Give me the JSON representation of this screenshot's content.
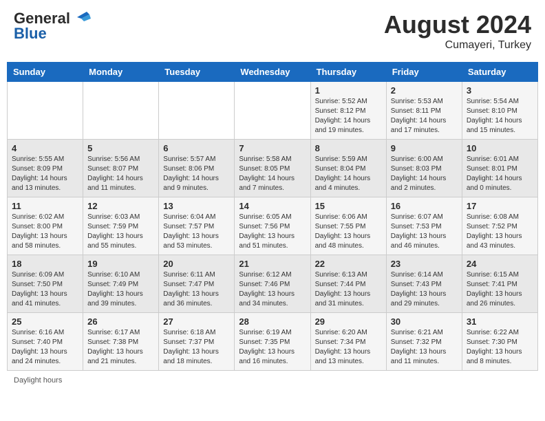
{
  "header": {
    "logo_line1": "General",
    "logo_line2": "Blue",
    "month_year": "August 2024",
    "location": "Cumayeri, Turkey"
  },
  "footer": {
    "daylight_label": "Daylight hours"
  },
  "days_of_week": [
    "Sunday",
    "Monday",
    "Tuesday",
    "Wednesday",
    "Thursday",
    "Friday",
    "Saturday"
  ],
  "weeks": [
    [
      {
        "day": "",
        "info": ""
      },
      {
        "day": "",
        "info": ""
      },
      {
        "day": "",
        "info": ""
      },
      {
        "day": "",
        "info": ""
      },
      {
        "day": "1",
        "info": "Sunrise: 5:52 AM\nSunset: 8:12 PM\nDaylight: 14 hours and 19 minutes."
      },
      {
        "day": "2",
        "info": "Sunrise: 5:53 AM\nSunset: 8:11 PM\nDaylight: 14 hours and 17 minutes."
      },
      {
        "day": "3",
        "info": "Sunrise: 5:54 AM\nSunset: 8:10 PM\nDaylight: 14 hours and 15 minutes."
      }
    ],
    [
      {
        "day": "4",
        "info": "Sunrise: 5:55 AM\nSunset: 8:09 PM\nDaylight: 14 hours and 13 minutes."
      },
      {
        "day": "5",
        "info": "Sunrise: 5:56 AM\nSunset: 8:07 PM\nDaylight: 14 hours and 11 minutes."
      },
      {
        "day": "6",
        "info": "Sunrise: 5:57 AM\nSunset: 8:06 PM\nDaylight: 14 hours and 9 minutes."
      },
      {
        "day": "7",
        "info": "Sunrise: 5:58 AM\nSunset: 8:05 PM\nDaylight: 14 hours and 7 minutes."
      },
      {
        "day": "8",
        "info": "Sunrise: 5:59 AM\nSunset: 8:04 PM\nDaylight: 14 hours and 4 minutes."
      },
      {
        "day": "9",
        "info": "Sunrise: 6:00 AM\nSunset: 8:03 PM\nDaylight: 14 hours and 2 minutes."
      },
      {
        "day": "10",
        "info": "Sunrise: 6:01 AM\nSunset: 8:01 PM\nDaylight: 14 hours and 0 minutes."
      }
    ],
    [
      {
        "day": "11",
        "info": "Sunrise: 6:02 AM\nSunset: 8:00 PM\nDaylight: 13 hours and 58 minutes."
      },
      {
        "day": "12",
        "info": "Sunrise: 6:03 AM\nSunset: 7:59 PM\nDaylight: 13 hours and 55 minutes."
      },
      {
        "day": "13",
        "info": "Sunrise: 6:04 AM\nSunset: 7:57 PM\nDaylight: 13 hours and 53 minutes."
      },
      {
        "day": "14",
        "info": "Sunrise: 6:05 AM\nSunset: 7:56 PM\nDaylight: 13 hours and 51 minutes."
      },
      {
        "day": "15",
        "info": "Sunrise: 6:06 AM\nSunset: 7:55 PM\nDaylight: 13 hours and 48 minutes."
      },
      {
        "day": "16",
        "info": "Sunrise: 6:07 AM\nSunset: 7:53 PM\nDaylight: 13 hours and 46 minutes."
      },
      {
        "day": "17",
        "info": "Sunrise: 6:08 AM\nSunset: 7:52 PM\nDaylight: 13 hours and 43 minutes."
      }
    ],
    [
      {
        "day": "18",
        "info": "Sunrise: 6:09 AM\nSunset: 7:50 PM\nDaylight: 13 hours and 41 minutes."
      },
      {
        "day": "19",
        "info": "Sunrise: 6:10 AM\nSunset: 7:49 PM\nDaylight: 13 hours and 39 minutes."
      },
      {
        "day": "20",
        "info": "Sunrise: 6:11 AM\nSunset: 7:47 PM\nDaylight: 13 hours and 36 minutes."
      },
      {
        "day": "21",
        "info": "Sunrise: 6:12 AM\nSunset: 7:46 PM\nDaylight: 13 hours and 34 minutes."
      },
      {
        "day": "22",
        "info": "Sunrise: 6:13 AM\nSunset: 7:44 PM\nDaylight: 13 hours and 31 minutes."
      },
      {
        "day": "23",
        "info": "Sunrise: 6:14 AM\nSunset: 7:43 PM\nDaylight: 13 hours and 29 minutes."
      },
      {
        "day": "24",
        "info": "Sunrise: 6:15 AM\nSunset: 7:41 PM\nDaylight: 13 hours and 26 minutes."
      }
    ],
    [
      {
        "day": "25",
        "info": "Sunrise: 6:16 AM\nSunset: 7:40 PM\nDaylight: 13 hours and 24 minutes."
      },
      {
        "day": "26",
        "info": "Sunrise: 6:17 AM\nSunset: 7:38 PM\nDaylight: 13 hours and 21 minutes."
      },
      {
        "day": "27",
        "info": "Sunrise: 6:18 AM\nSunset: 7:37 PM\nDaylight: 13 hours and 18 minutes."
      },
      {
        "day": "28",
        "info": "Sunrise: 6:19 AM\nSunset: 7:35 PM\nDaylight: 13 hours and 16 minutes."
      },
      {
        "day": "29",
        "info": "Sunrise: 6:20 AM\nSunset: 7:34 PM\nDaylight: 13 hours and 13 minutes."
      },
      {
        "day": "30",
        "info": "Sunrise: 6:21 AM\nSunset: 7:32 PM\nDaylight: 13 hours and 11 minutes."
      },
      {
        "day": "31",
        "info": "Sunrise: 6:22 AM\nSunset: 7:30 PM\nDaylight: 13 hours and 8 minutes."
      }
    ]
  ]
}
